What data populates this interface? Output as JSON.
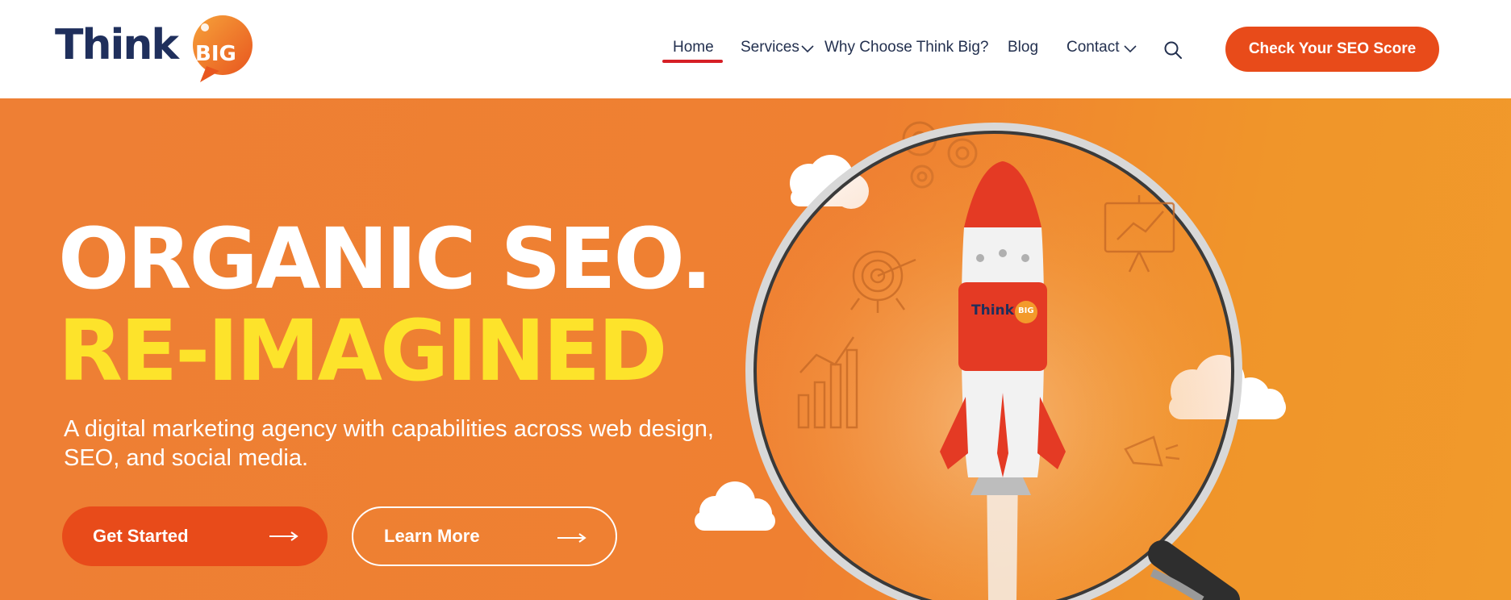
{
  "logo": {
    "text": "Think",
    "badge": "BIG"
  },
  "nav": {
    "items": [
      {
        "label": "Home",
        "active": true
      },
      {
        "label": "Services",
        "has_dropdown": true
      },
      {
        "label": "Why Choose Think Big?"
      },
      {
        "label": "Blog"
      },
      {
        "label": "Contact",
        "has_dropdown": true
      }
    ],
    "search_icon": "search-icon",
    "cta_label": "Check Your SEO Score"
  },
  "hero": {
    "headline_line1": "ORGANIC SEO.",
    "headline_line2": "RE-IMAGINED",
    "subtext": "A digital marketing agency with capabilities across web design, SEO, and social media.",
    "primary_button": "Get Started",
    "secondary_button": "Learn More",
    "rocket_badge_text": "Think",
    "rocket_badge_big": "BIG"
  },
  "colors": {
    "brand_orange": "#e84b1a",
    "hero_bg": "#ef8033",
    "headline_yellow": "#fde32b",
    "nav_text": "#23304f",
    "active_underline": "#d61f26",
    "logo_navy": "#1f2f5c"
  }
}
